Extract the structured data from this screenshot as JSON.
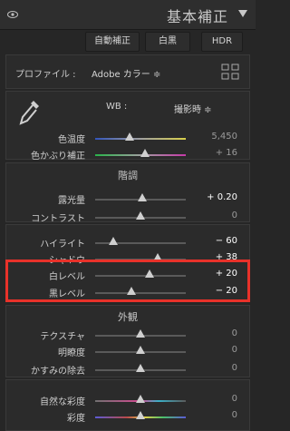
{
  "header": {
    "title": "基本補正"
  },
  "toolbar": {
    "auto_label": "自動補正",
    "bw_label": "白黒",
    "hdr_label": "HDR"
  },
  "profile": {
    "label": "プロファイル :",
    "value": "Adobe カラー ≑"
  },
  "wb": {
    "label": "WB :",
    "value": "撮影時 ≑"
  },
  "sliders": [
    {
      "label": "色温度",
      "value": "5,450",
      "pos": 0.38,
      "active": false
    },
    {
      "label": "色かぶり補正",
      "value": "+ 16",
      "pos": 0.55,
      "active": false
    },
    {
      "label": "露光量",
      "value": "+ 0.20",
      "pos": 0.52,
      "active": true
    },
    {
      "label": "コントラスト",
      "value": "0",
      "pos": 0.5,
      "active": false
    },
    {
      "label": "ハイライト",
      "value": "− 60",
      "pos": 0.2,
      "active": true
    },
    {
      "label": "シャドウ",
      "value": "+ 38",
      "pos": 0.69,
      "active": true
    },
    {
      "label": "白レベル",
      "value": "+ 20",
      "pos": 0.6,
      "active": true
    },
    {
      "label": "黒レベル",
      "value": "− 20",
      "pos": 0.4,
      "active": true
    },
    {
      "label": "テクスチャ",
      "value": "0",
      "pos": 0.5,
      "active": false
    },
    {
      "label": "明瞭度",
      "value": "0",
      "pos": 0.5,
      "active": false
    },
    {
      "label": "かすみの除去",
      "value": "0",
      "pos": 0.5,
      "active": false
    },
    {
      "label": "自然な彩度",
      "value": "0",
      "pos": 0.5,
      "active": false
    },
    {
      "label": "彩度",
      "value": "0",
      "pos": 0.5,
      "active": false
    }
  ],
  "sections": {
    "tone": "階調",
    "presence": "外観"
  },
  "colors": {
    "highlight": "#e8322a",
    "accent": "#cfcfcf"
  },
  "icons": [
    "eye-icon",
    "collapse-caret-icon",
    "grid-icon",
    "eyedropper-icon"
  ]
}
